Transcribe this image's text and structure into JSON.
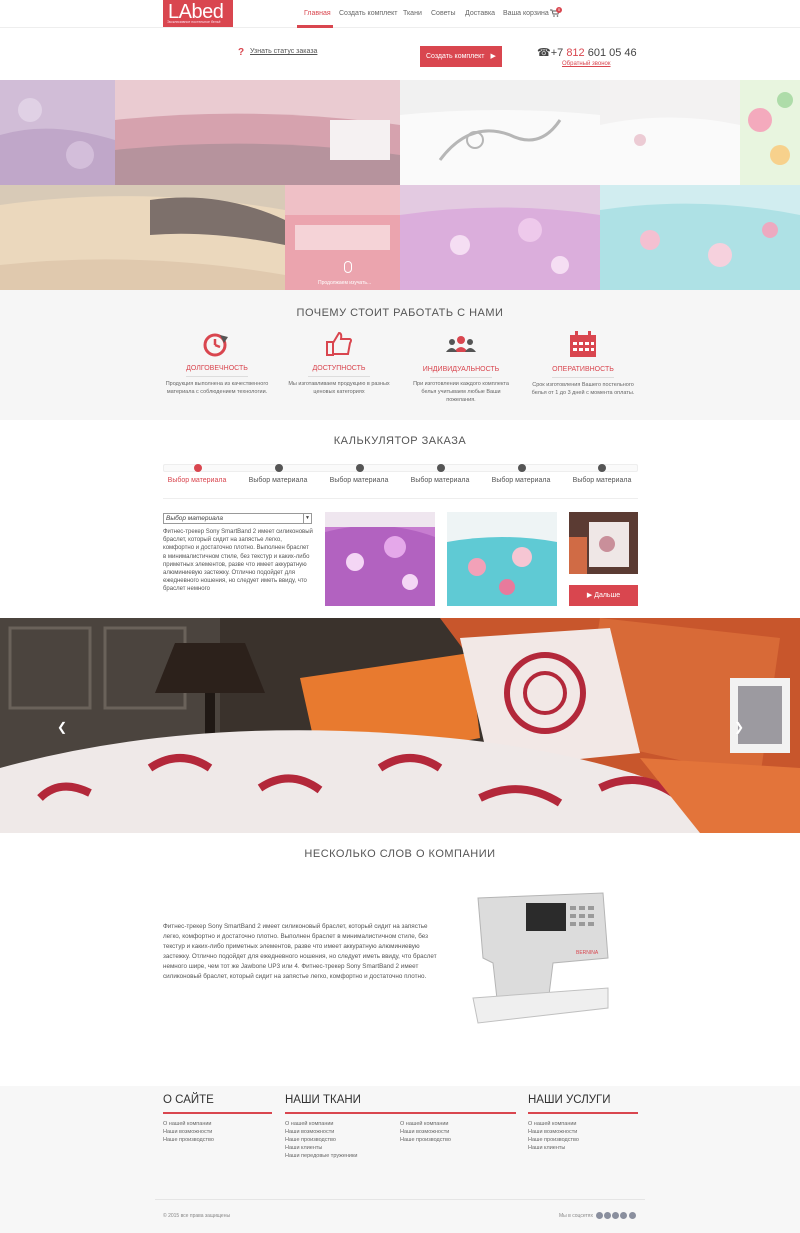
{
  "header": {
    "logo": {
      "text": "LAbed",
      "tagline": "Эксклюзивное постельное бельё"
    },
    "nav": [
      "Главная",
      "Создать комплект",
      "Ткани",
      "Советы",
      "Доставка",
      "Ваша корзина"
    ],
    "cart_count": "0"
  },
  "subheader": {
    "status_link": "Узнать статус заказа",
    "create_button": "Создать комплект",
    "phone_prefix": "☎+7",
    "phone_code": "812",
    "phone_number": "601 05 46",
    "callback": "Обратный звонок"
  },
  "hero": {
    "scroll_hint": "Продолжаем изучать..."
  },
  "why": {
    "title": "ПОЧЕМУ СТОИТ РАБОТАТЬ С НАМИ",
    "features": [
      {
        "icon": "durability-icon",
        "title": "ДОЛГОВЕЧНОСТЬ",
        "desc": "Продукция выполнена из качественного материала с соблюдением технологии."
      },
      {
        "icon": "thumbs-up-icon",
        "title": "ДОСТУПНОСТЬ",
        "desc": "Мы изготавливаем продукцию в разных ценовых категориях"
      },
      {
        "icon": "people-icon",
        "title": "ИНДИВИДУАЛЬНОСТЬ",
        "desc": "При изготовлении каждого комплекта белья учитываем любые Ваши пожелания."
      },
      {
        "icon": "calendar-icon",
        "title": "ОПЕРАТИВНОСТЬ",
        "desc": "Срок изготовления Вашего постельного белья от 1 до 3 дней с момента оплаты."
      }
    ]
  },
  "calculator": {
    "title": "КАЛЬКУЛЯТОР ЗАКАЗА",
    "steps": [
      "Выбор материала",
      "Выбор материала",
      "Выбор материала",
      "Выбор материала",
      "Выбор материала",
      "Выбор материала"
    ],
    "select_value": "Выбор материала",
    "description": "Фитнес-трекер Sony SmartBand 2 имеет силиконовый браслет, который сидит на запястье легко, комфортно и достаточно плотно. Выполнен браслет в минималистичном стиле, без текстур и каких-либо приметных элементов, разве что имеет аккуратную алюминиевую застежку. Отлично подойдет для ежедневного ношения, но следует иметь ввиду, что браслет немного",
    "next_button": "▶ Дальше"
  },
  "about": {
    "title": "НЕСКОЛЬКО СЛОВ О КОМПАНИИ",
    "text": "Фитнес-трекер Sony SmartBand 2 имеет силиконовый браслет, который сидит на запястье легко, комфортно и достаточно плотно. Выполнен браслет в минималистичном стиле, без текстур и каких-либо приметных элементов, разве что имеет аккуратную алюминиевую застежку. Отлично подойдет для ежедневного ношения, но следует иметь ввиду, что браслет немного шире, чем тот же Jawbone UP3 или 4. Фитнес-трекер Sony SmartBand 2 имеет силиконовый браслет, который сидит на запястье легко, комфортно и достаточно плотно.",
    "machine_brand": "BERNINA"
  },
  "footer": {
    "col1": {
      "title": "О САЙТЕ",
      "links": [
        "О нашей компании",
        "Наши возможности",
        "Наше производство"
      ]
    },
    "col2": {
      "title": "НАШИ ТКАНИ",
      "links_a": [
        "О нашей компании",
        "Наши возможности",
        "Наше производство",
        "Наши клиенты",
        "Наши передовые труженики"
      ],
      "links_b": [
        "О нашей компании",
        "Наши возможности",
        "Наше производство"
      ]
    },
    "col3": {
      "title": "НАШИ УСЛУГИ",
      "links": [
        "О нашей компании",
        "Наши возможности",
        "Наше производство",
        "Наши клиенты"
      ]
    },
    "copyright": "© 2015 все права защищены",
    "social_label": "Мы в соцсетях",
    "social_icons": [
      "odnoklassniki-icon",
      "vk-icon",
      "twitter-icon",
      "facebook-icon",
      "google-plus-icon"
    ]
  },
  "colors": {
    "accent": "#d9464f"
  }
}
